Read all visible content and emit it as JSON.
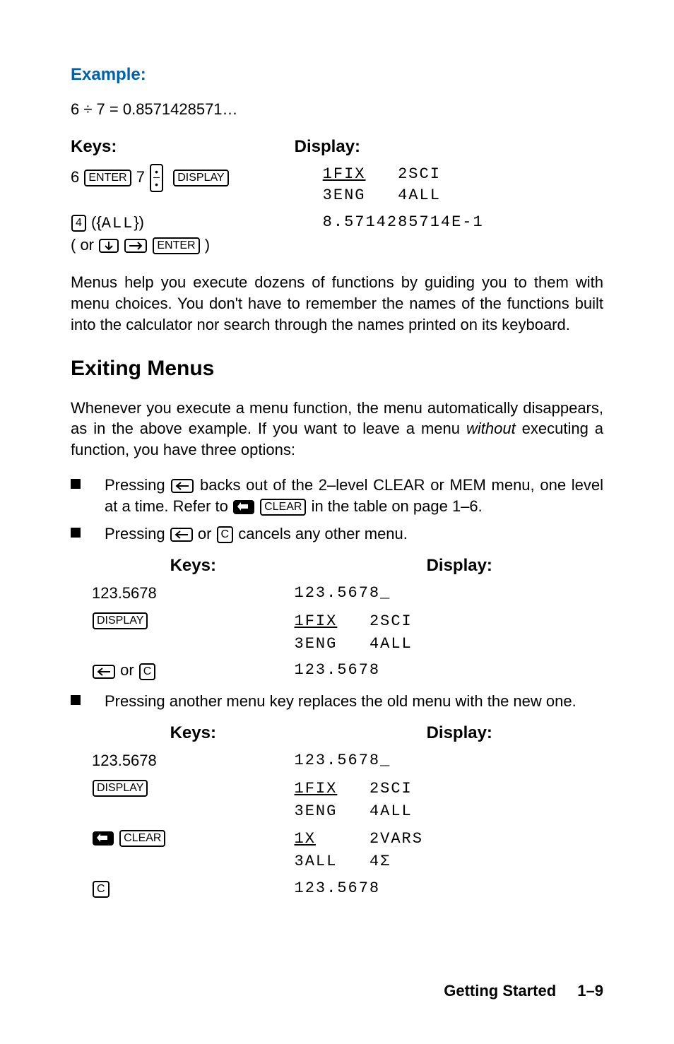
{
  "example_label": "Example:",
  "equation": "6 ÷ 7 = 0.8571428571…",
  "table1": {
    "keys_hdr": "Keys:",
    "disp_hdr": "Display:",
    "row1": {
      "pre6": "6 ",
      "enter": "ENTER",
      "mid": " 7 ",
      "display_key": "DISPLAY",
      "d_l1_a": "1FIX",
      "d_l1_b": "2SCI",
      "d_l2_a": "3ENG",
      "d_l2_b": "4ALL"
    },
    "row2": {
      "four": "4",
      "all": " ({",
      "all_txt": "ALL",
      "all_close": "})",
      "or_open": "( or ",
      "enter2": "ENTER",
      "or_close": " )",
      "disp": "8.5714285714E-1"
    }
  },
  "para1": "Menus help you execute dozens of functions by guiding you to them with menu choices. You don't have to remember the names of the functions built into the calculator nor search through the names printed on its keyboard.",
  "section_heading": "Exiting Menus",
  "para2_a": "Whenever you execute a menu function, the menu automatically disappears, as in the above example. If you want to leave a menu ",
  "para2_italic": "without",
  "para2_b": " executing a function, you have three options:",
  "bullets": {
    "b1_a": "Pressing ",
    "b1_b": " backs out of the 2–level CLEAR or MEM menu, one level at a time. Refer to ",
    "b1_clear": "CLEAR",
    "b1_c": " in the table on page 1–6.",
    "b2_a": "Pressing ",
    "b2_or": " or ",
    "b2_c": "C",
    "b2_b": " cancels any other menu.",
    "b3": "Pressing another menu key replaces the old menu with the new one."
  },
  "inner1": {
    "keys_hdr": "Keys:",
    "disp_hdr": "Display:",
    "r1_keys": "123.5678",
    "r1_disp": "123.5678_",
    "display_key": "DISPLAY",
    "d_l1_a": "1FIX",
    "d_l1_b": "2SCI",
    "d_l2_a": "3ENG",
    "d_l2_b": "4ALL",
    "r3_or": " or ",
    "r3_c": "C",
    "r3_disp": "123.5678"
  },
  "inner2": {
    "keys_hdr": "Keys:",
    "disp_hdr": "Display:",
    "r1_keys": "123.5678",
    "r1_disp": "123.5678_",
    "display_key": "DISPLAY",
    "d_l1_a": "1FIX",
    "d_l1_b": "2SCI",
    "d_l2_a": "3ENG",
    "d_l2_b": "4ALL",
    "clear": "CLEAR",
    "cl_l1_a": "1X",
    "cl_l1_b": "2VARS",
    "cl_l2_a": "3ALL",
    "cl_l2_b": "4Σ",
    "r4_c": "C",
    "r4_disp": "123.5678"
  },
  "footer": {
    "section": "Getting Started",
    "page": "1–9"
  }
}
